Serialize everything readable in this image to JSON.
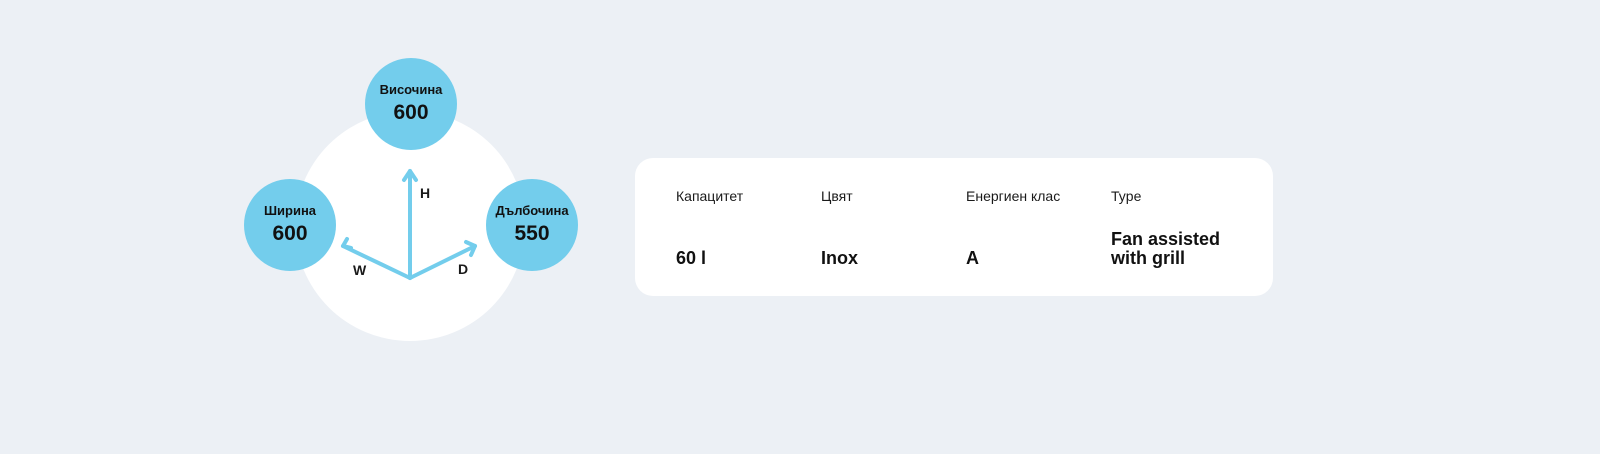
{
  "dimensions": {
    "height": {
      "label": "Височина",
      "value": "600"
    },
    "width": {
      "label": "Ширина",
      "value": "600"
    },
    "depth": {
      "label": "Дълбочина",
      "value": "550"
    },
    "axes": {
      "h": "H",
      "w": "W",
      "d": "D"
    }
  },
  "specs": [
    {
      "label": "Капацитет",
      "value": "60 l"
    },
    {
      "label": "Цвят",
      "value": "Inox"
    },
    {
      "label": "Енергиен клас",
      "value": "A"
    },
    {
      "label": "Type",
      "value": "Fan assisted with grill"
    }
  ],
  "colors": {
    "background": "#ECF0F5",
    "accent": "#73CDEC",
    "card": "#FFFFFF"
  }
}
